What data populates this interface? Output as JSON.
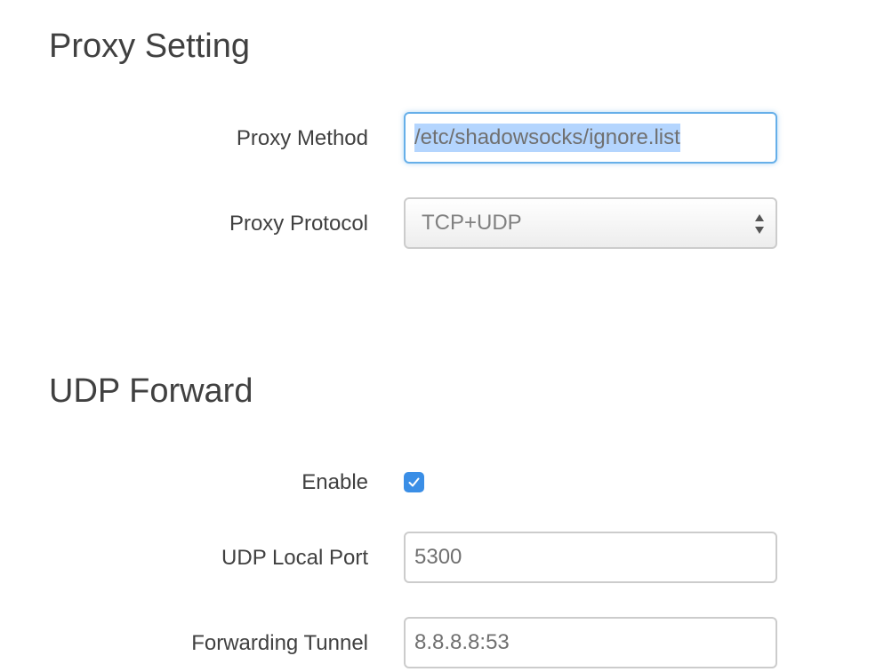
{
  "proxy_setting": {
    "title": "Proxy Setting",
    "method": {
      "label": "Proxy Method",
      "value": "/etc/shadowsocks/ignore.list"
    },
    "protocol": {
      "label": "Proxy Protocol",
      "value": "TCP+UDP",
      "icon": "select-arrows-icon"
    }
  },
  "udp_forward": {
    "title": "UDP Forward",
    "enable": {
      "label": "Enable",
      "checked": true,
      "icon": "checkmark-icon"
    },
    "local_port": {
      "label": "UDP Local Port",
      "value": "5300"
    },
    "forwarding_tunnel": {
      "label": "Forwarding Tunnel",
      "value": "8.8.8.8:53"
    }
  },
  "colors": {
    "focus": "#66afe9",
    "selection": "#b4d5fe",
    "checkbox": "#3a8ee6",
    "text": "#404040"
  }
}
